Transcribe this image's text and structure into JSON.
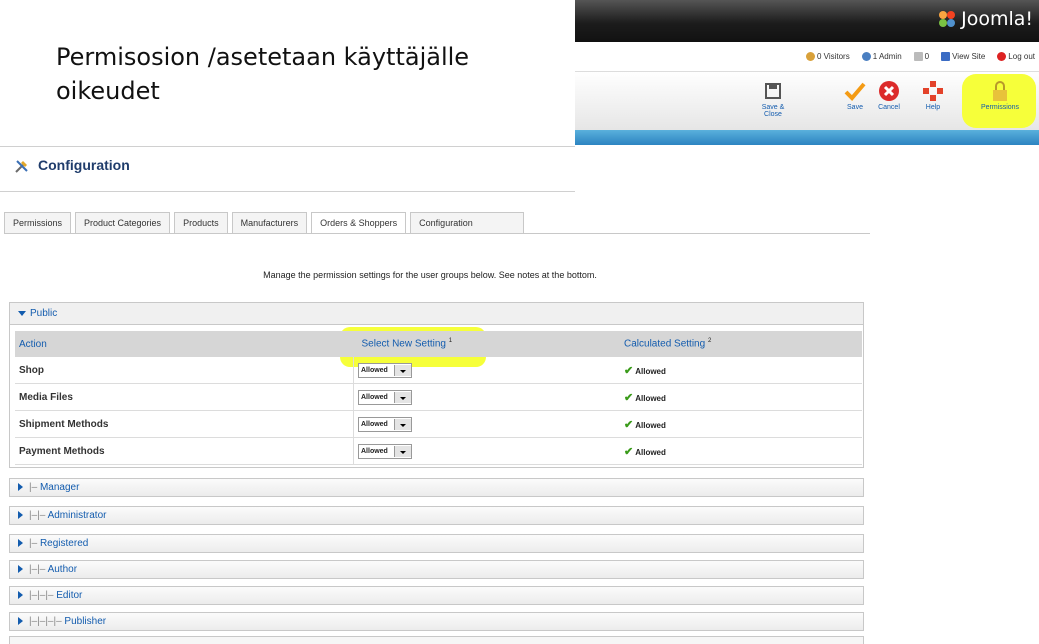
{
  "slide": {
    "title_line1": "Permisosion /asetetaan käyttäjälle",
    "title_line2": "oikeudet"
  },
  "joomla": {
    "logo_text": "Joomla!",
    "status": {
      "visitors": "0 Visitors",
      "admin": "1 Admin",
      "messages": "0",
      "view_site": "View Site",
      "logout": "Log out"
    },
    "toolbar": {
      "save_close": "Save & Close",
      "save": "Save",
      "cancel": "Cancel",
      "help": "Help",
      "permissions": "Permissions"
    }
  },
  "page": {
    "title": "Configuration"
  },
  "tabs": [
    {
      "label": "Permissions"
    },
    {
      "label": "Product Categories"
    },
    {
      "label": "Products"
    },
    {
      "label": "Manufacturers"
    },
    {
      "label": "Orders & Shoppers"
    },
    {
      "label": "Configuration"
    }
  ],
  "active_tab": "Orders & Shoppers",
  "notes_text": "Manage the permission settings for the user groups below. See notes at the bottom.",
  "public_group": {
    "label": "Public",
    "headers": {
      "action": "Action",
      "select_new": "Select New Setting",
      "select_new_sup": "1",
      "calculated": "Calculated Setting",
      "calculated_sup": "2"
    },
    "rows": [
      {
        "action": "Shop",
        "setting": "Allowed",
        "calculated": "Allowed"
      },
      {
        "action": "Media Files",
        "setting": "Allowed",
        "calculated": "Allowed"
      },
      {
        "action": "Shipment Methods",
        "setting": "Allowed",
        "calculated": "Allowed"
      },
      {
        "action": "Payment Methods",
        "setting": "Allowed",
        "calculated": "Allowed"
      }
    ]
  },
  "groups": [
    {
      "prefix": "|–",
      "label": "Manager"
    },
    {
      "prefix": "|–|–",
      "label": "Administrator"
    },
    {
      "prefix": "|–",
      "label": "Registered"
    },
    {
      "prefix": "|–|–",
      "label": "Author"
    },
    {
      "prefix": "|–|–|–",
      "label": "Editor"
    },
    {
      "prefix": "|–|–|–|–",
      "label": "Publisher"
    }
  ],
  "colors": {
    "highlight": "#f6ff3a",
    "link_blue": "#135cae",
    "allowed_green": "#3a9b1a"
  }
}
